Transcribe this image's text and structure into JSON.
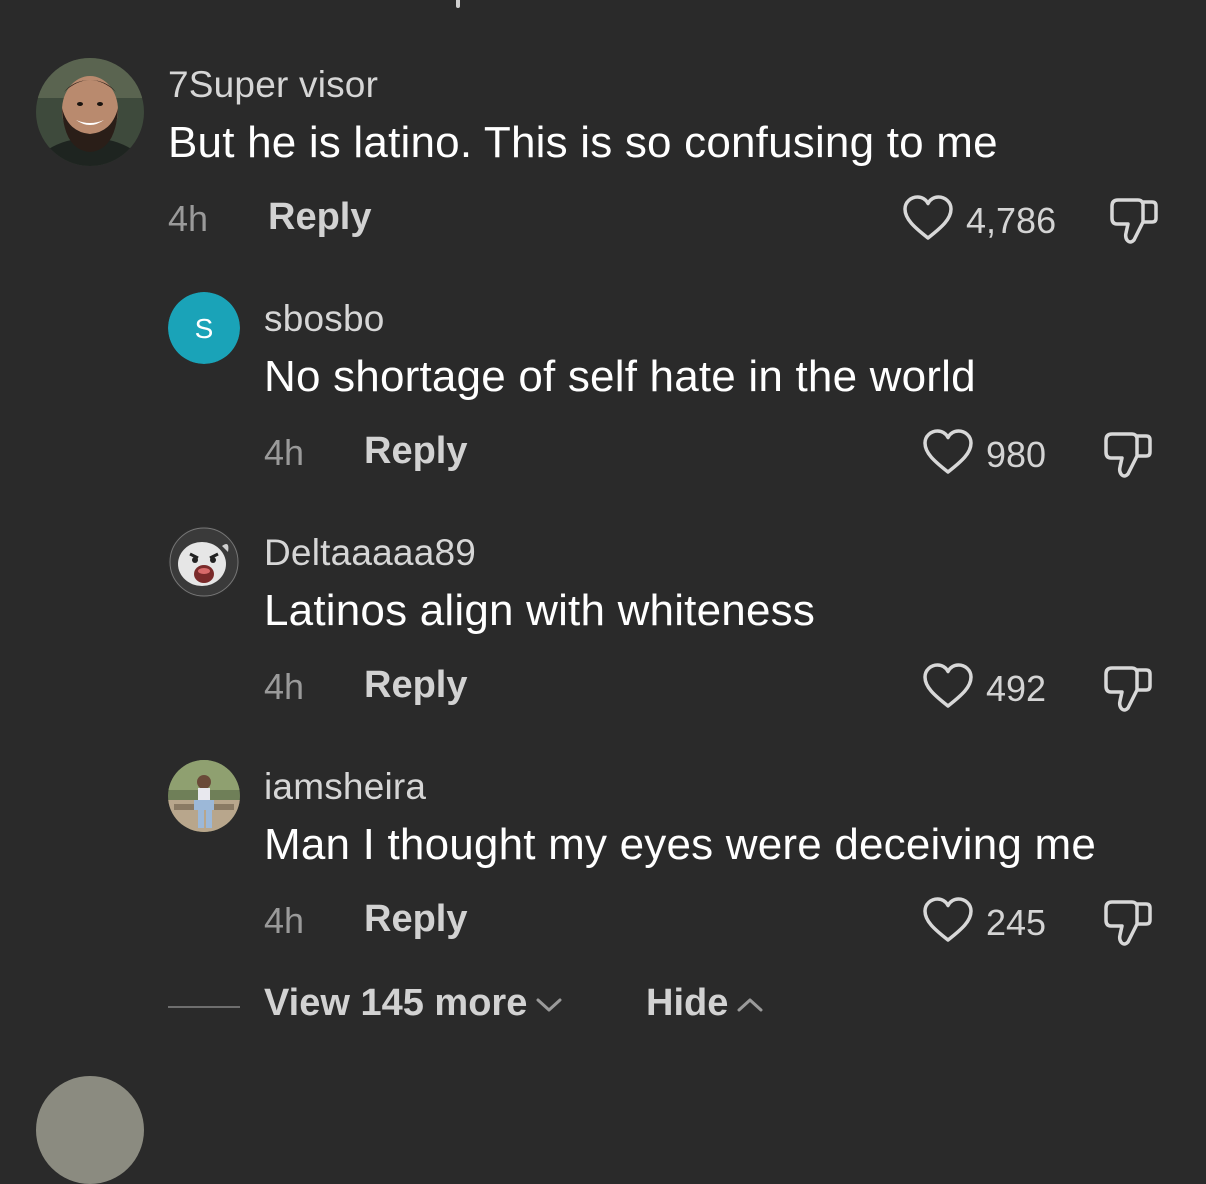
{
  "comments": [
    {
      "username": "7Super visor",
      "text": "But he is latino. This is so confusing to me",
      "time": "4h",
      "reply_label": "Reply",
      "likes": "4,786",
      "avatar": "photo-bearded-man"
    },
    {
      "username": "sbosbo",
      "text": "No shortage of self hate in the world",
      "time": "4h",
      "reply_label": "Reply",
      "likes": "980",
      "avatar_letter": "S",
      "avatar_color": "#1aa3b8"
    },
    {
      "username": "Deltaaaaa89",
      "text": "Latinos align with whiteness",
      "time": "4h",
      "reply_label": "Reply",
      "likes": "492",
      "avatar": "boo-ghost"
    },
    {
      "username": "iamsheira",
      "text": "Man I thought my eyes were deceiving me",
      "time": "4h",
      "reply_label": "Reply",
      "likes": "245",
      "avatar": "photo-woman-sitting"
    }
  ],
  "footer": {
    "view_more_label": "View 145 more",
    "hide_label": "Hide"
  },
  "colors": {
    "background": "#2a2a2a",
    "text_primary": "#ffffff",
    "text_secondary": "#9a9a9a"
  }
}
